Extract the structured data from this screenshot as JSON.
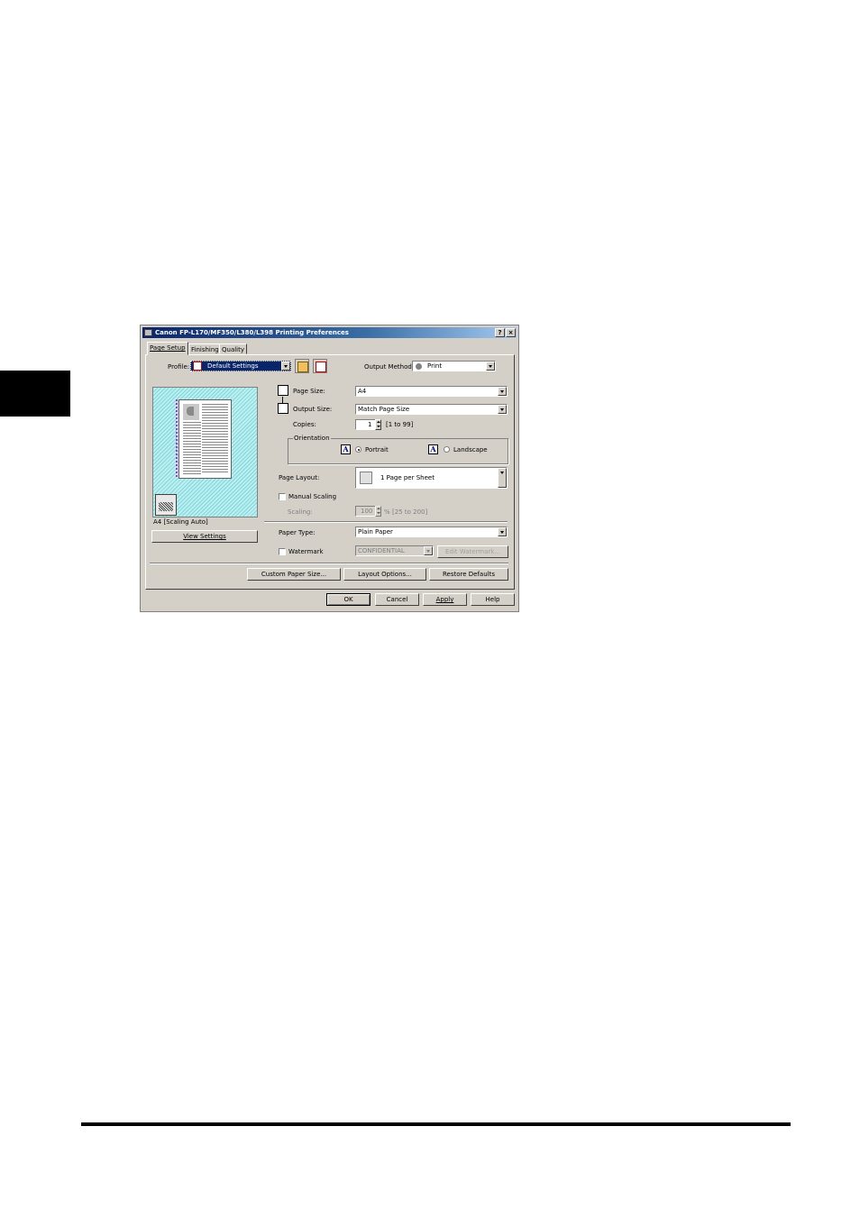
{
  "window": {
    "title": "Canon FP-L170/MF350/L380/L398 Printing Preferences",
    "help_btn": "?",
    "close_btn": "×"
  },
  "tabs": [
    {
      "label": "Page Setup",
      "active": true
    },
    {
      "label": "Finishing",
      "active": false
    },
    {
      "label": "Quality",
      "active": false
    }
  ],
  "profile": {
    "label": "Profile:",
    "value": "Default Settings"
  },
  "output_method": {
    "label": "Output Method:",
    "value": "Print"
  },
  "preview": {
    "caption": "A4 [Scaling Auto]",
    "view_settings_button": "View Settings"
  },
  "page_size": {
    "label": "Page Size:",
    "value": "A4"
  },
  "output_size": {
    "label": "Output Size:",
    "value": "Match Page Size"
  },
  "copies": {
    "label": "Copies:",
    "value": "1",
    "range": "[1 to 99]"
  },
  "orientation": {
    "group_label": "Orientation",
    "portrait": "Portrait",
    "landscape": "Landscape",
    "icon_letter": "A"
  },
  "page_layout": {
    "label": "Page Layout:",
    "value": "1 Page per Sheet"
  },
  "manual_scaling": {
    "label": "Manual Scaling"
  },
  "scaling": {
    "label": "Scaling:",
    "value": "100",
    "unit": "%",
    "range": "[25 to 200]"
  },
  "paper_type": {
    "label": "Paper Type:",
    "value": "Plain Paper"
  },
  "watermark": {
    "label": "Watermark",
    "value": "CONFIDENTIAL",
    "edit_button": "Edit Watermark..."
  },
  "actions": {
    "custom_paper_size": "Custom Paper Size...",
    "layout_options": "Layout Options...",
    "restore_defaults": "Restore Defaults"
  },
  "footer": {
    "ok": "OK",
    "cancel": "Cancel",
    "apply": "Apply",
    "help": "Help"
  },
  "colors": {
    "titlebar": "#0a246a",
    "dialog_bg": "#d4d0c8",
    "selection": "#0a246a"
  }
}
